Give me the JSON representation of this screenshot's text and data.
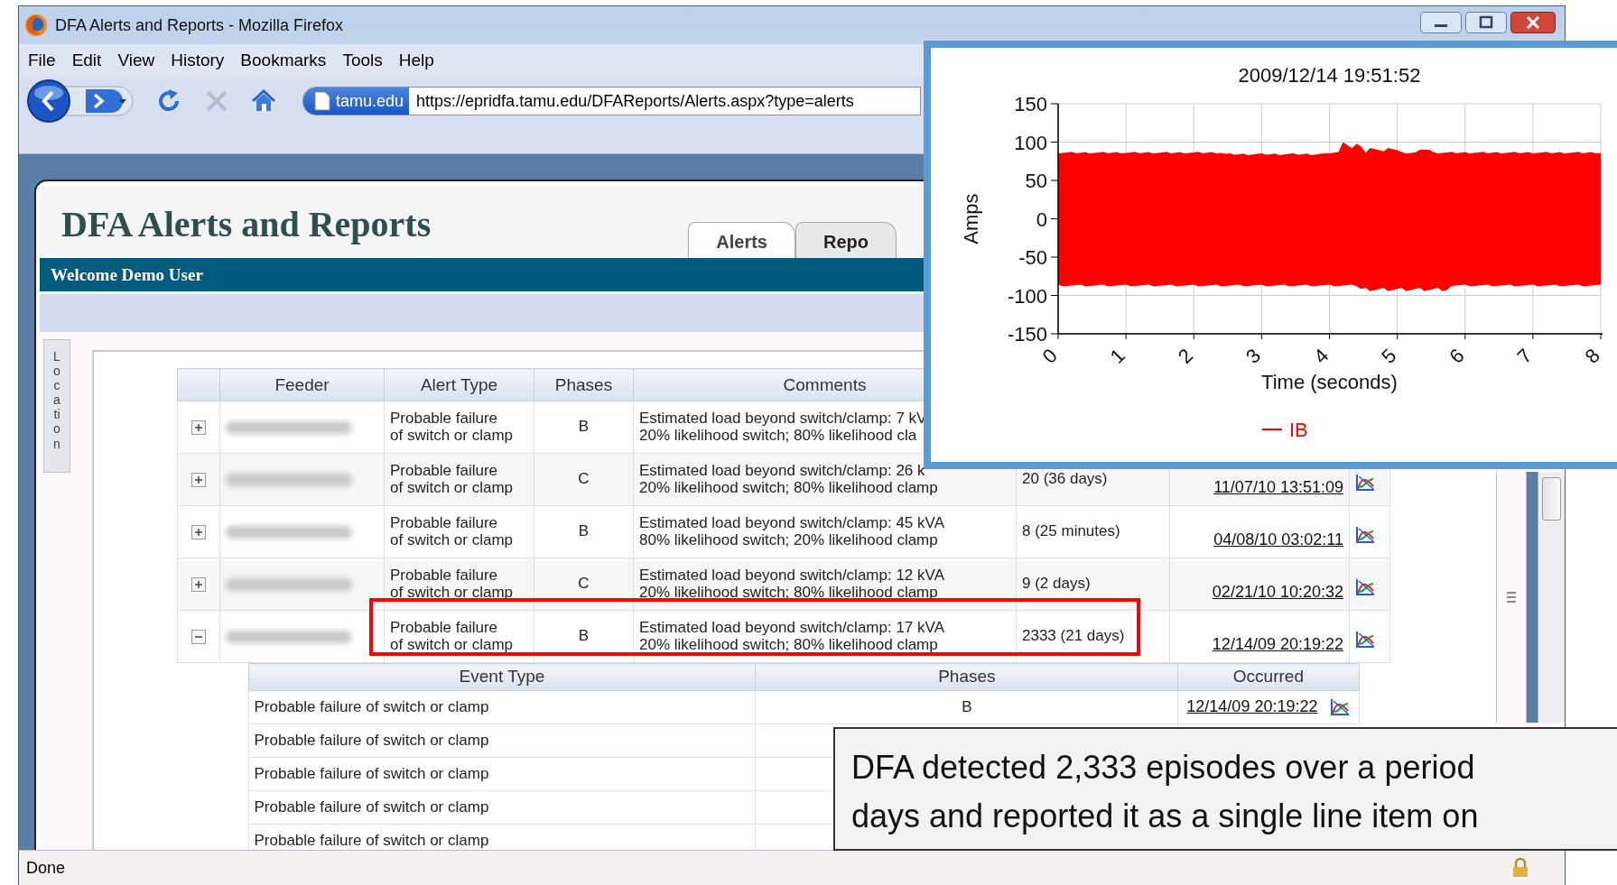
{
  "window": {
    "title": "DFA Alerts and Reports - Mozilla Firefox"
  },
  "menu": [
    "File",
    "Edit",
    "View",
    "History",
    "Bookmarks",
    "Tools",
    "Help"
  ],
  "address_bar": {
    "site_badge": "tamu.edu",
    "url": "https://epridfa.tamu.edu/DFAReports/Alerts.aspx?type=alerts"
  },
  "page": {
    "heading": "DFA Alerts and Reports",
    "tabs": [
      {
        "label": "Alerts",
        "selected": true
      },
      {
        "label": "Repo",
        "selected": false
      }
    ],
    "welcome": "Welcome Demo User",
    "side_tab": "Location"
  },
  "alerts_table": {
    "columns": [
      "Feeder",
      "Alert Type",
      "Phases",
      "Comments"
    ],
    "rows": [
      {
        "expanded": false,
        "alert_type": "Probable failure\nof switch or clamp",
        "phases": "B",
        "comments": "Estimated load beyond switch/clamp: 7 kV\n20% likelihood switch; 80% likelihood cla"
      },
      {
        "expanded": false,
        "alert_type": "Probable failure\nof switch or clamp",
        "phases": "C",
        "comments": "Estimated load beyond switch/clamp: 26 k\n20% likelihood switch; 80% likelihood clamp",
        "count": "20 (36 days)",
        "occurred": "11/07/10 13:51:09"
      },
      {
        "expanded": false,
        "alert_type": "Probable failure\nof switch or clamp",
        "phases": "B",
        "comments": "Estimated load beyond switch/clamp: 45 kVA\n80% likelihood switch; 20% likelihood clamp",
        "count": "8 (25 minutes)",
        "occurred": "04/08/10 03:02:11"
      },
      {
        "expanded": false,
        "alert_type": "Probable failure\nof switch or clamp",
        "phases": "C",
        "comments": "Estimated load beyond switch/clamp: 12 kVA\n20% likelihood switch; 80% likelihood clamp",
        "count": "9 (2 days)",
        "occurred": "02/21/10 10:20:32"
      },
      {
        "expanded": true,
        "alert_type": "Probable failure\nof switch or clamp",
        "phases": "B",
        "comments": "Estimated load beyond switch/clamp: 17 kVA\n20% likelihood switch; 80% likelihood clamp",
        "count": "2333 (21 days)",
        "occurred": "12/14/09 20:19:22"
      }
    ]
  },
  "events_table": {
    "columns": [
      "Event Type",
      "Phases",
      "Occurred"
    ],
    "rows": [
      {
        "event_type": "Probable failure of switch or clamp",
        "phases": "B",
        "occurred": "12/14/09 20:19:22"
      },
      {
        "event_type": "Probable failure of switch or clamp"
      },
      {
        "event_type": "Probable failure of switch or clamp"
      },
      {
        "event_type": "Probable failure of switch or clamp"
      },
      {
        "event_type": "Probable failure of switch or clamp"
      }
    ]
  },
  "status_bar": {
    "text": "Done"
  },
  "waveform_plot": {
    "title": "2009/12/14 19:51:52",
    "ylabel": "Amps",
    "xlabel": "Time (seconds)",
    "yticks": [
      "150",
      "100",
      "50",
      "0",
      "-50",
      "-100",
      "-150"
    ],
    "xticks": [
      "0",
      "1",
      "2",
      "3",
      "4",
      "5",
      "6",
      "7",
      "8"
    ],
    "legend": "IB"
  },
  "callout": {
    "lines": [
      "DFA detected 2,333 episodes over a period",
      "days and reported it as a single line item on"
    ]
  }
}
